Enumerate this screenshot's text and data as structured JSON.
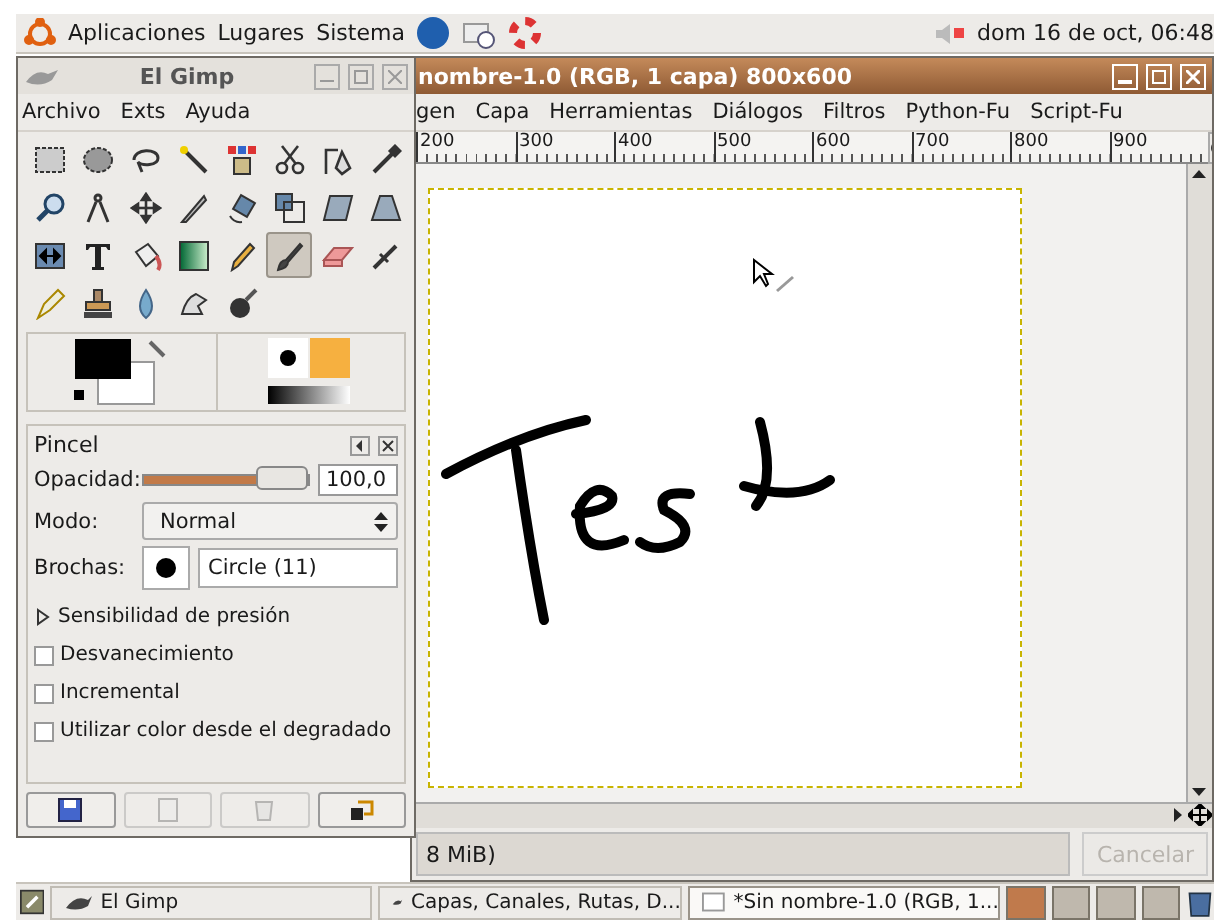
{
  "top_panel": {
    "menus": [
      "Aplicaciones",
      "Lugares",
      "Sistema"
    ],
    "clock": "dom 16 de oct, 06:48"
  },
  "image_window": {
    "title": "nombre-1.0 (RGB, 1 capa) 800x600",
    "menu": [
      "gen",
      "Capa",
      "Herramientas",
      "Diálogos",
      "Filtros",
      "Python-Fu",
      "Script-Fu"
    ],
    "ruler_labels": [
      "200",
      "300",
      "400",
      "500",
      "600",
      "700",
      "800",
      "900"
    ],
    "status": "8 MiB)",
    "cancel_button": {
      "label": "Cancelar",
      "disabled": true
    }
  },
  "toolbox": {
    "title": "El Gimp",
    "menu": [
      "Archivo",
      "Exts",
      "Ayuda"
    ],
    "tools": [
      {
        "kind": "rect",
        "selected": false
      },
      {
        "kind": "ellipse",
        "selected": false
      },
      {
        "kind": "lasso",
        "selected": false
      },
      {
        "kind": "wand",
        "selected": false
      },
      {
        "kind": "color-select",
        "selected": false
      },
      {
        "kind": "scissors",
        "selected": false
      },
      {
        "kind": "paths",
        "selected": false
      },
      {
        "kind": "picker",
        "selected": false
      },
      {
        "kind": "zoom",
        "selected": false
      },
      {
        "kind": "measure",
        "selected": false
      },
      {
        "kind": "move",
        "selected": false
      },
      {
        "kind": "crop",
        "selected": false
      },
      {
        "kind": "rotate",
        "selected": false
      },
      {
        "kind": "scale",
        "selected": false
      },
      {
        "kind": "shear",
        "selected": false
      },
      {
        "kind": "perspective",
        "selected": false
      },
      {
        "kind": "flip",
        "selected": false
      },
      {
        "kind": "text",
        "selected": false
      },
      {
        "kind": "bucket",
        "selected": false
      },
      {
        "kind": "gradient",
        "selected": false
      },
      {
        "kind": "pencil",
        "selected": false
      },
      {
        "kind": "brush",
        "selected": true
      },
      {
        "kind": "eraser",
        "selected": false
      },
      {
        "kind": "airbrush",
        "selected": false
      },
      {
        "kind": "ink",
        "selected": false
      },
      {
        "kind": "clone",
        "selected": false
      },
      {
        "kind": "blur",
        "selected": false
      },
      {
        "kind": "smudge",
        "selected": false
      },
      {
        "kind": "dodge",
        "selected": false
      }
    ],
    "options": {
      "title": "Pincel",
      "opacity": {
        "label": "Opacidad:",
        "level": 1.0,
        "value": "100,0"
      },
      "mode": {
        "label": "Modo:",
        "value": "Normal"
      },
      "brush": {
        "label": "Brochas:",
        "value": "Circle (11)"
      },
      "expander": {
        "label": "Sensibilidad de presión",
        "expanded": false
      },
      "checkboxes": [
        {
          "label": "Desvanecimiento",
          "checked": false
        },
        {
          "label": "Incremental",
          "checked": false
        },
        {
          "label": "Utilizar color desde el degradado",
          "checked": false
        }
      ],
      "buttons": [
        {
          "kind": "save",
          "disabled": false
        },
        {
          "kind": "restore",
          "disabled": true
        },
        {
          "kind": "delete",
          "disabled": true
        },
        {
          "kind": "reset",
          "disabled": false
        }
      ]
    }
  },
  "taskbar": {
    "items": [
      {
        "label": "El Gimp",
        "selected": false
      },
      {
        "label": "Capas, Canales, Rutas, D...",
        "selected": false
      },
      {
        "label": "*Sin nombre-1.0 (RGB, 1...",
        "selected": true
      }
    ],
    "workspaces": [
      {
        "selected": true
      },
      {
        "selected": false
      },
      {
        "selected": false
      },
      {
        "selected": false
      }
    ]
  }
}
